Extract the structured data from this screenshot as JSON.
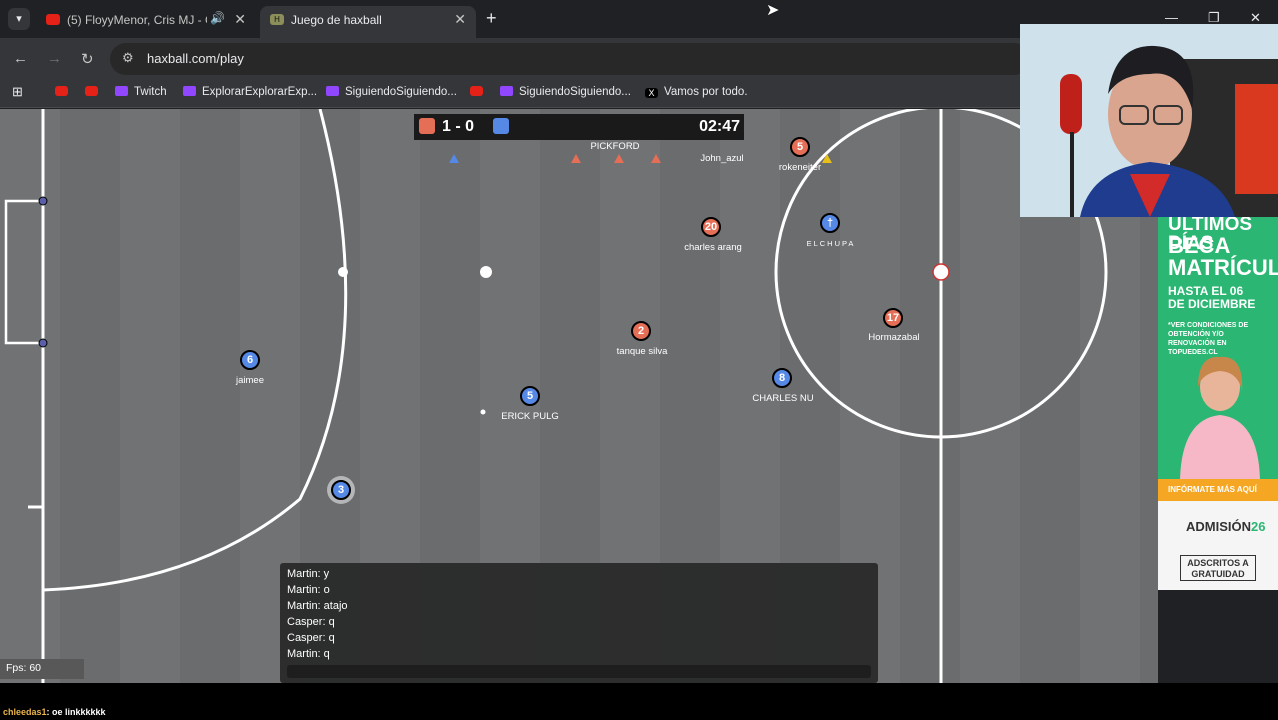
{
  "browser": {
    "tabs": [
      {
        "title": "(5) FloyyMenor, Cris MJ - G",
        "active": false,
        "favicon": "youtube-icon"
      },
      {
        "title": "Juego de haxball",
        "active": true,
        "favicon": "haxball-icon"
      }
    ],
    "url": "haxball.com/play",
    "bookmarks": [
      {
        "label": "",
        "icon": "youtube-icon"
      },
      {
        "label": "",
        "icon": "youtube-icon"
      },
      {
        "label": "Twitch",
        "icon": "twitch-icon"
      },
      {
        "label": "ExplorarExplorarExp...",
        "icon": "twitch-icon"
      },
      {
        "label": "SiguiendoSiguiendo...",
        "icon": "twitch-icon"
      },
      {
        "label": "",
        "icon": "youtube-icon"
      },
      {
        "label": "SiguiendoSiguiendo...",
        "icon": "twitch-icon"
      },
      {
        "label": "Vamos por todo.",
        "icon": "x-icon"
      }
    ]
  },
  "game": {
    "score": "1 - 0",
    "time": "02:47",
    "colors": {
      "red": "#e56e56",
      "blue": "#5689e5",
      "field": "#6f7072"
    },
    "players": [
      {
        "number": "5",
        "team": "red",
        "name": "rokeneiter"
      },
      {
        "number": "20",
        "team": "red",
        "name": "charles arang"
      },
      {
        "number": "2",
        "team": "red",
        "name": "tanque silva"
      },
      {
        "number": "17",
        "team": "red",
        "name": "Hormazabal"
      },
      {
        "number": "†",
        "team": "blue",
        "name": "ELCHUPA"
      },
      {
        "number": "6",
        "team": "blue",
        "name": "jaimee"
      },
      {
        "number": "5",
        "team": "blue",
        "name": "ERICK PULG"
      },
      {
        "number": "8",
        "team": "blue",
        "name": "CHARLES NU"
      },
      {
        "number": "3",
        "team": "blue",
        "name": ""
      }
    ],
    "offscreen_labels": [
      "PICKFORD",
      "John_azul"
    ],
    "fps": "Fps: 60",
    "chat": [
      "Martin: y",
      "Martin: o",
      "Martin: atajo",
      "Casper: q",
      "Casper: q",
      "Martin: q"
    ]
  },
  "ad": {
    "headline1": "ÚLTIMOS DÍAS",
    "headline2": "BECA",
    "headline3": "MATRÍCULA*",
    "date": "HASTA EL 06",
    "date2": "DE DICIEMBRE",
    "fine_print": "*VER CONDICIONES DE OBTENCIÓN Y/O RENOVACIÓN EN TOPUEDES.CL",
    "cta": "INFÓRMATE MÁS AQUÍ",
    "admision": "ADMISIÓN",
    "admision_year": "26",
    "gratuidad": "ADSCRITOS A GRATUIDAD"
  },
  "stream_chat": {
    "user": "chleedas1",
    "message": ": oe linkkkkkk"
  }
}
